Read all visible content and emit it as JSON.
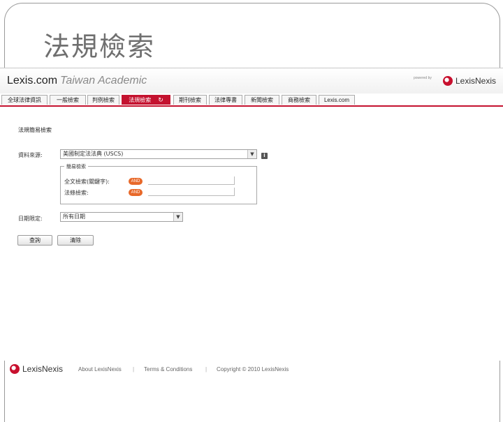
{
  "slide": {
    "title": "法規檢索"
  },
  "header": {
    "brand_main": "Lexis.com",
    "brand_sub": "Taiwan Academic",
    "powered_by": "powered by",
    "logo_text": "LexisNexis"
  },
  "tabs": [
    {
      "label": "全球法律資訊"
    },
    {
      "label": "一般檢索"
    },
    {
      "label": "判例檢索"
    },
    {
      "label": "法規檢索",
      "refresh": "↻"
    },
    {
      "label": "期刊檢索"
    },
    {
      "label": "法律專書"
    },
    {
      "label": "新聞檢索"
    },
    {
      "label": "商務檢索"
    },
    {
      "label": "Lexis.com"
    }
  ],
  "form": {
    "title": "法規簡易檢索",
    "source_label": "資料來源:",
    "source_value": "美國制定法法典 (USCS)",
    "info": "i",
    "simple_legend": "簡易檢索",
    "fulltext_label": "全文檢索(關鍵字):",
    "and1": "AND",
    "section_label": "法條檢索:",
    "and2": "AND",
    "date_label": "日期限定:",
    "date_value": "所有日期",
    "search_button": "查詢",
    "clear_button": "清除"
  },
  "footer": {
    "logo_text": "LexisNexis",
    "about": "About LexisNexis",
    "sep1": "|",
    "terms": "Terms & Conditions",
    "sep2": "|",
    "copyright": "Copyright © 2010 LexisNexis"
  },
  "colors": {
    "accent": "#c4122f",
    "and_badge": "#e8692a"
  }
}
